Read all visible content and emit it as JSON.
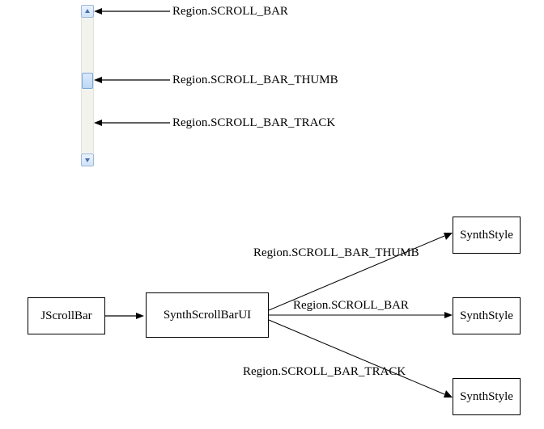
{
  "topLabels": {
    "scrollBar": "Region.SCROLL_BAR",
    "thumb": "Region.SCROLL_BAR_THUMB",
    "track": "Region.SCROLL_BAR_TRACK"
  },
  "nodes": {
    "jscrollbar": "JScrollBar",
    "ui": "SynthScrollBarUI",
    "style1": "SynthStyle",
    "style2": "SynthStyle",
    "style3": "SynthStyle"
  },
  "edges": {
    "uiToStyle1": "Region.SCROLL_BAR_THUMB",
    "uiToStyle2": "Region.SCROLL_BAR",
    "uiToStyle3": "Region.SCROLL_BAR_TRACK"
  }
}
